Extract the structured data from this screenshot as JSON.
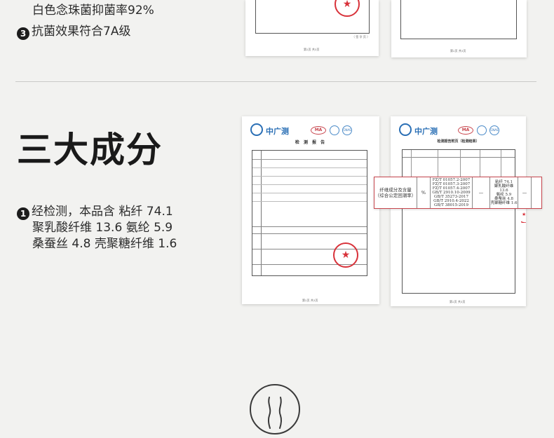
{
  "top_section": {
    "line1": "白色念珠菌抑菌率92%",
    "item3_num": "3",
    "item3_text": "抗菌效果符合7A级"
  },
  "main_section": {
    "title": "三大成分",
    "item1_num": "1",
    "item1_lines": [
      "经检测，本品含 粘纤 74.1",
      "聚乳酸纤维 13.6  氨纶 5.9",
      "桑蚕丝 4.8  壳聚糖纤维 1.6"
    ]
  },
  "report": {
    "brand": "中广测",
    "ma_mark": "MA",
    "cnas_mark": "CNAS",
    "report_title": "检 测 报 告",
    "page_title_2": "检测报告附页（检测结果）",
    "footer_1": "第2页  共3页",
    "footer_2": "第2页  共3页",
    "seal_mark": "★"
  },
  "highlight": {
    "item": "纤维成分及含量\n（综合公定回潮率）",
    "unit": "%",
    "standards": "FZ/T 01057.2-2007\nFZ/T 01057.3-2007\nFZ/T 01057.4-2007\nGB/T 2910.10-2009\nGB/T 35273-2017\nGB/T 2910.4-2022\nGB/T 38015-2019",
    "dash1": "—",
    "result": "粘纤 74.1\n聚乳酸纤维 13.6\n氨纶 5.9\n桑蚕丝 4.8\n壳聚糖纤维 1.6",
    "dash2": "—"
  },
  "colors": {
    "accent_red": "#c8464e",
    "brand_blue": "#2a6fb5"
  },
  "icons": {
    "bottom": "body-silhouette-icon"
  }
}
